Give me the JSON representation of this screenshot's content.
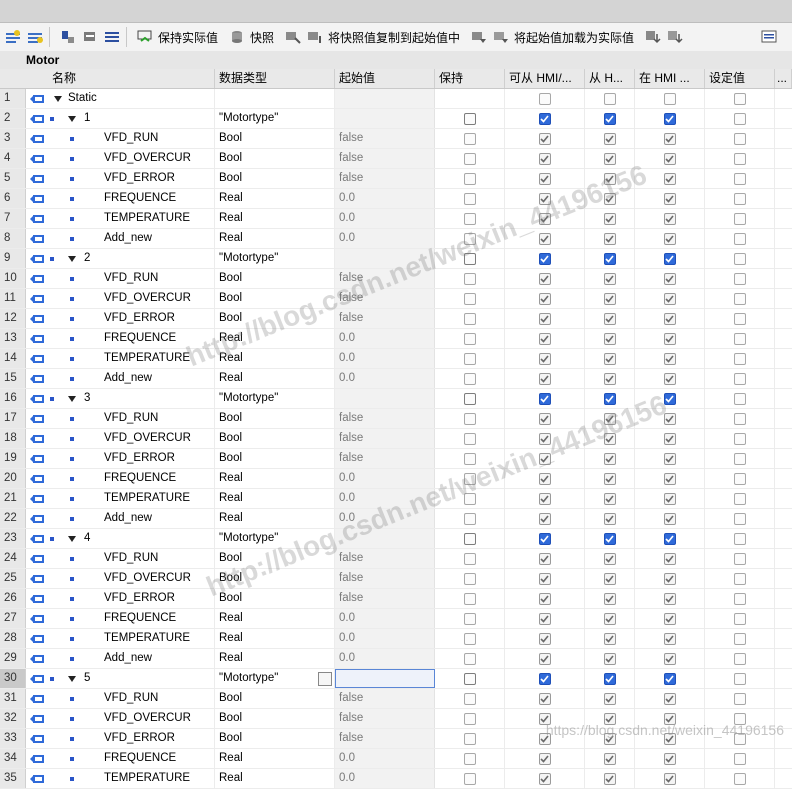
{
  "toolbar": {
    "keep_actual_label": "保持实际值",
    "snapshot_label": "快照",
    "copy_snapshot_label": "将快照值复制到起始值中",
    "load_start_label": "将起始值加载为实际值"
  },
  "block": {
    "title": "Motor"
  },
  "columns": {
    "name": "名称",
    "datatype": "数据类型",
    "start": "起始值",
    "keep": "保持",
    "hmi_access": "可从 HMI/...",
    "hmi_write": "从 H...",
    "hmi_visible": "在 HMI ...",
    "setpoint": "设定值",
    "more": "..."
  },
  "rows": [
    {
      "n": "1",
      "name": "Static",
      "type": "",
      "start": ""
    },
    {
      "n": "2",
      "name": "1",
      "type": "\"Motortype\"",
      "start": ""
    },
    {
      "n": "3",
      "name": "VFD_RUN",
      "type": "Bool",
      "start": "false"
    },
    {
      "n": "4",
      "name": "VFD_OVERCUR",
      "type": "Bool",
      "start": "false"
    },
    {
      "n": "5",
      "name": "VFD_ERROR",
      "type": "Bool",
      "start": "false"
    },
    {
      "n": "6",
      "name": "FREQUENCE",
      "type": "Real",
      "start": "0.0"
    },
    {
      "n": "7",
      "name": "TEMPERATURE",
      "type": "Real",
      "start": "0.0"
    },
    {
      "n": "8",
      "name": "Add_new",
      "type": "Real",
      "start": "0.0"
    },
    {
      "n": "9",
      "name": "2",
      "type": "\"Motortype\"",
      "start": ""
    },
    {
      "n": "10",
      "name": "VFD_RUN",
      "type": "Bool",
      "start": "false"
    },
    {
      "n": "11",
      "name": "VFD_OVERCUR",
      "type": "Bool",
      "start": "false"
    },
    {
      "n": "12",
      "name": "VFD_ERROR",
      "type": "Bool",
      "start": "false"
    },
    {
      "n": "13",
      "name": "FREQUENCE",
      "type": "Real",
      "start": "0.0"
    },
    {
      "n": "14",
      "name": "TEMPERATURE",
      "type": "Real",
      "start": "0.0"
    },
    {
      "n": "15",
      "name": "Add_new",
      "type": "Real",
      "start": "0.0"
    },
    {
      "n": "16",
      "name": "3",
      "type": "\"Motortype\"",
      "start": ""
    },
    {
      "n": "17",
      "name": "VFD_RUN",
      "type": "Bool",
      "start": "false"
    },
    {
      "n": "18",
      "name": "VFD_OVERCUR",
      "type": "Bool",
      "start": "false"
    },
    {
      "n": "19",
      "name": "VFD_ERROR",
      "type": "Bool",
      "start": "false"
    },
    {
      "n": "20",
      "name": "FREQUENCE",
      "type": "Real",
      "start": "0.0"
    },
    {
      "n": "21",
      "name": "TEMPERATURE",
      "type": "Real",
      "start": "0.0"
    },
    {
      "n": "22",
      "name": "Add_new",
      "type": "Real",
      "start": "0.0"
    },
    {
      "n": "23",
      "name": "4",
      "type": "\"Motortype\"",
      "start": ""
    },
    {
      "n": "24",
      "name": "VFD_RUN",
      "type": "Bool",
      "start": "false"
    },
    {
      "n": "25",
      "name": "VFD_OVERCUR",
      "type": "Bool",
      "start": "false"
    },
    {
      "n": "26",
      "name": "VFD_ERROR",
      "type": "Bool",
      "start": "false"
    },
    {
      "n": "27",
      "name": "FREQUENCE",
      "type": "Real",
      "start": "0.0"
    },
    {
      "n": "28",
      "name": "TEMPERATURE",
      "type": "Real",
      "start": "0.0"
    },
    {
      "n": "29",
      "name": "Add_new",
      "type": "Real",
      "start": "0.0"
    },
    {
      "n": "30",
      "name": "5",
      "type": "\"Motortype\"",
      "start": ""
    },
    {
      "n": "31",
      "name": "VFD_RUN",
      "type": "Bool",
      "start": "false"
    },
    {
      "n": "32",
      "name": "VFD_OVERCUR",
      "type": "Bool",
      "start": "false"
    },
    {
      "n": "33",
      "name": "VFD_ERROR",
      "type": "Bool",
      "start": "false"
    },
    {
      "n": "34",
      "name": "FREQUENCE",
      "type": "Real",
      "start": "0.0"
    },
    {
      "n": "35",
      "name": "TEMPERATURE",
      "type": "Real",
      "start": "0.0"
    }
  ],
  "watermark": {
    "main": "http://blog.csdn.net/weixin_44196156",
    "corner": "https://blog.csdn.net/weixin_44196156"
  },
  "colors": {
    "accent": "#2f6ad9",
    "header_bg": "#e9e9e9",
    "start_bg": "#f2f2f2"
  }
}
